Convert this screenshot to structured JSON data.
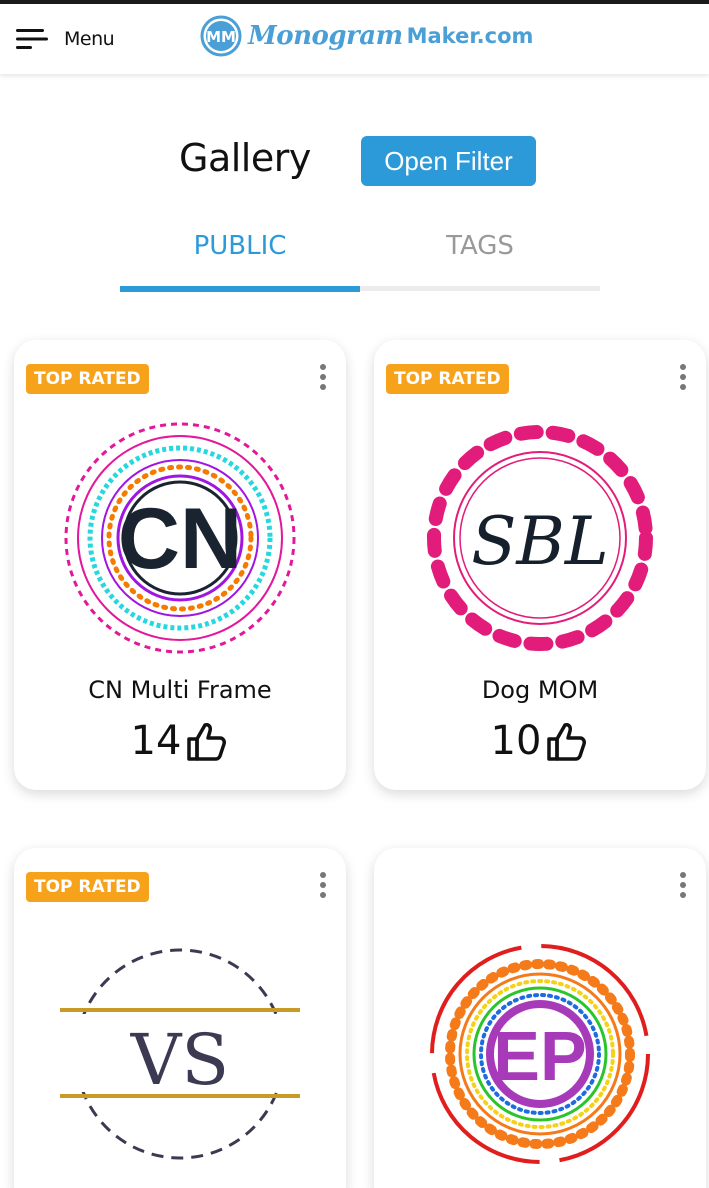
{
  "header": {
    "menu_label": "Menu",
    "logo_mark_text": "MM",
    "logo_script": "Monogram",
    "logo_domain": "Maker.com"
  },
  "gallery": {
    "title": "Gallery",
    "open_filter_label": "Open Filter"
  },
  "tabs": [
    {
      "label": "PUBLIC",
      "active": true
    },
    {
      "label": "TAGS",
      "active": false
    }
  ],
  "cards": [
    {
      "badge": "TOP RATED",
      "initials": "CN",
      "name": "CN Multi Frame",
      "likes": "14"
    },
    {
      "badge": "TOP RATED",
      "initials": "SBL",
      "name": "Dog MOM",
      "likes": "10"
    },
    {
      "badge": "TOP RATED",
      "initials": "VS",
      "name": "",
      "likes": ""
    },
    {
      "badge": "",
      "initials": "EP",
      "name": "",
      "likes": ""
    }
  ],
  "colors": {
    "accent": "#2c9ad9",
    "badge": "#f7a21b",
    "logo": "#4a9fd6"
  }
}
